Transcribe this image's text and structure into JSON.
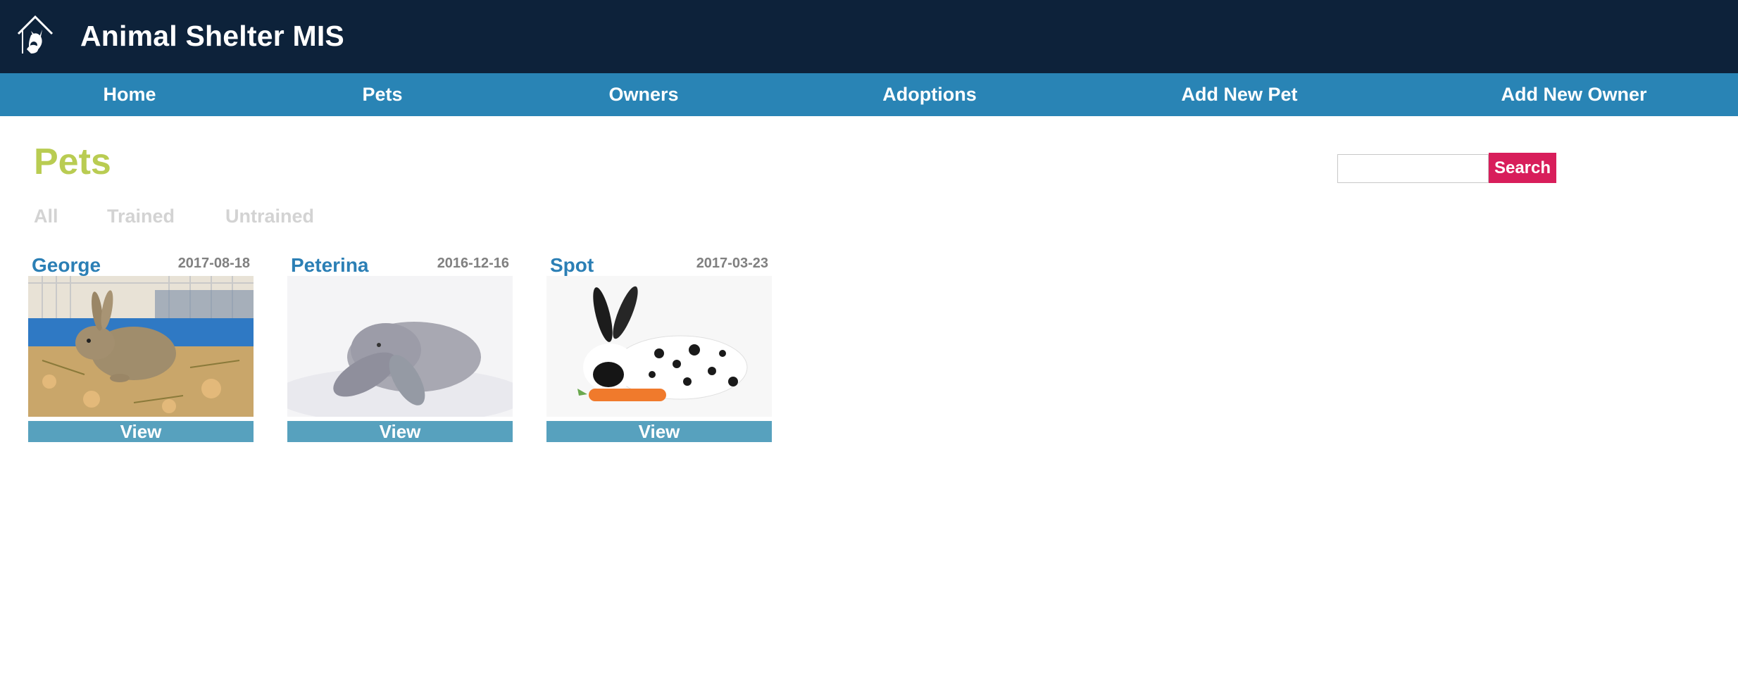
{
  "app": {
    "title": "Animal Shelter MIS",
    "logo_icon": "shelter-house-pets-icon"
  },
  "nav": {
    "items": [
      {
        "label": "Home"
      },
      {
        "label": "Pets"
      },
      {
        "label": "Owners"
      },
      {
        "label": "Adoptions"
      },
      {
        "label": "Add New Pet"
      },
      {
        "label": "Add New Owner"
      }
    ]
  },
  "page": {
    "title": "Pets",
    "filters": [
      {
        "label": "All"
      },
      {
        "label": "Trained"
      },
      {
        "label": "Untrained"
      }
    ]
  },
  "search": {
    "value": "",
    "placeholder": "",
    "button_label": "Search"
  },
  "pets": [
    {
      "name": "George",
      "date": "2017-08-18",
      "view_label": "View",
      "photo": "brown rabbit in hay enclosure"
    },
    {
      "name": "Peterina",
      "date": "2016-12-16",
      "view_label": "View",
      "photo": "grey lop rabbit on white"
    },
    {
      "name": "Spot",
      "date": "2017-03-23",
      "view_label": "View",
      "photo": "black and white spotted rabbit with carrot"
    }
  ],
  "colors": {
    "header_bg": "#0d223a",
    "nav_bg": "#2984b5",
    "title_green": "#b9cc52",
    "search_pink": "#d81e5b",
    "view_btn": "#57a1be",
    "pet_name_blue": "#2b7fb5"
  }
}
